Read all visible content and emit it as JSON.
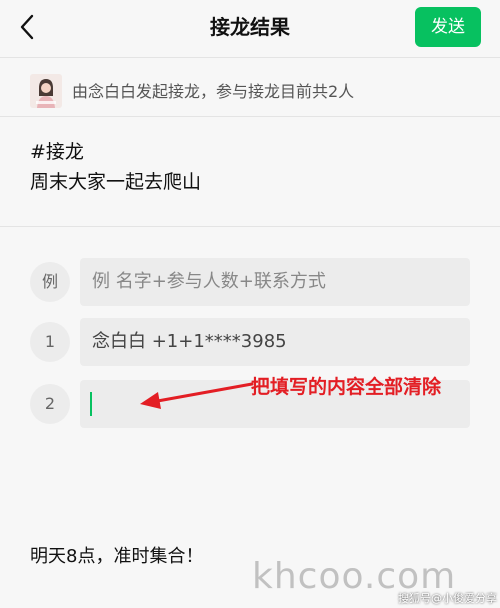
{
  "header": {
    "title": "接龙结果",
    "send_label": "发送",
    "back_icon": "chevron-left-icon"
  },
  "initiator": {
    "text": "由念白白发起接龙，参与接龙目前共2人"
  },
  "subject": {
    "line1": "#接龙",
    "line2": "周末大家一起去爬山"
  },
  "entries": [
    {
      "index": "例",
      "value": "例 名字+参与人数+联系方式",
      "is_placeholder": true
    },
    {
      "index": "1",
      "value": "念白白 +1+1****3985"
    },
    {
      "index": "2",
      "value": ""
    }
  ],
  "annotation": {
    "text": "把填写的内容全部清除",
    "color": "#e31e24"
  },
  "note": {
    "text": "明天8点，准时集合！"
  },
  "watermark": {
    "text": "khcoo.com"
  },
  "source_credit": {
    "text": "搜狐号@小俊爱分享"
  },
  "colors": {
    "accent": "#07c160",
    "background": "#f7f7f7",
    "field": "#ececec"
  }
}
